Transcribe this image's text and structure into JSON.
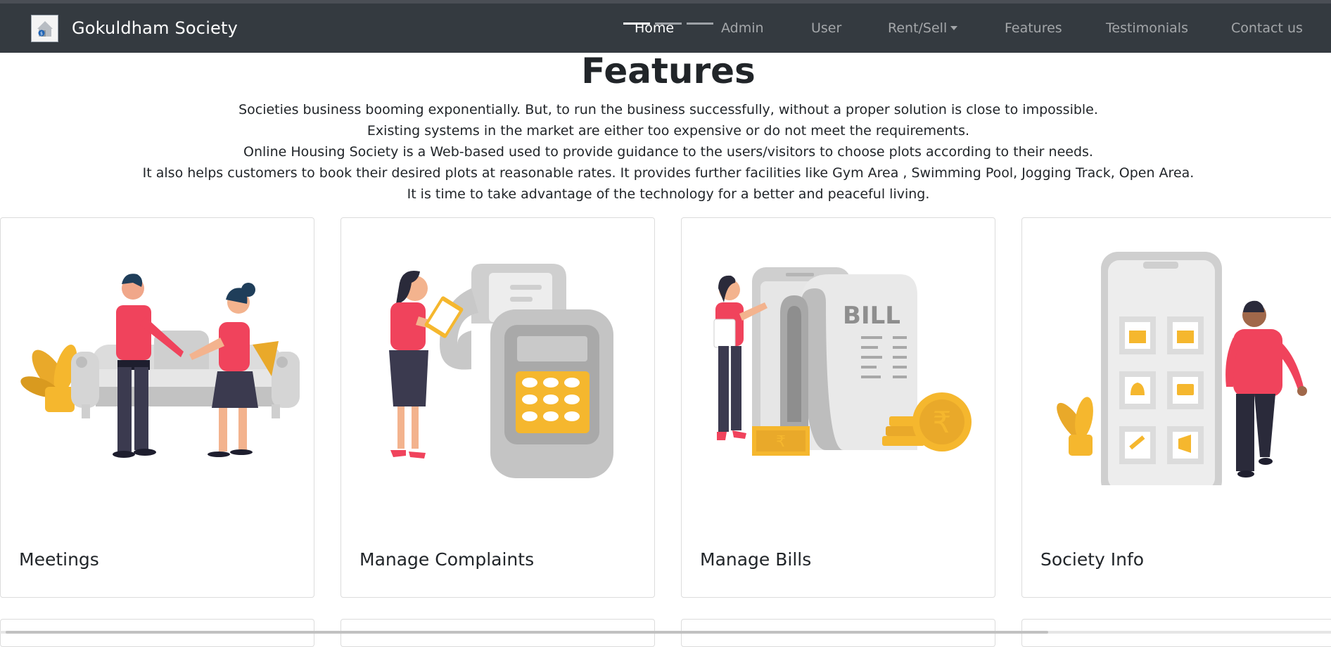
{
  "navbar": {
    "brand": "Gokuldham Society",
    "links": [
      "Home",
      "Admin",
      "User",
      "Rent/Sell",
      "Features",
      "Testimonials",
      "Contact us"
    ],
    "active": "Home"
  },
  "features": {
    "title": "Features",
    "lines": [
      "Societies business booming exponentially. But, to run the business successfully, without a proper solution is close to impossible.",
      "Existing systems in the market are either too expensive or do not meet the requirements.",
      "Online Housing Society is a Web-based used to provide guidance to the users/visitors to choose plots according to their needs.",
      "It also helps customers to book their desired plots at reasonable rates. It provides further facilities like Gym Area , Swimming Pool, Jogging Track, Open Area.",
      "It is time to take advantage of the technology for a better and peaceful living."
    ],
    "cards": [
      {
        "title": "Meetings"
      },
      {
        "title": "Manage Complaints"
      },
      {
        "title": "Manage Bills"
      },
      {
        "title": "Society Info"
      }
    ]
  },
  "illustrations": {
    "bill_text": "BILL",
    "rupee_symbol": "₹"
  },
  "colors": {
    "navbar_bg": "#343a40",
    "accent_red": "#f0435c",
    "accent_yellow": "#f5b72e",
    "illustration_gray": "#c8c8c8"
  }
}
